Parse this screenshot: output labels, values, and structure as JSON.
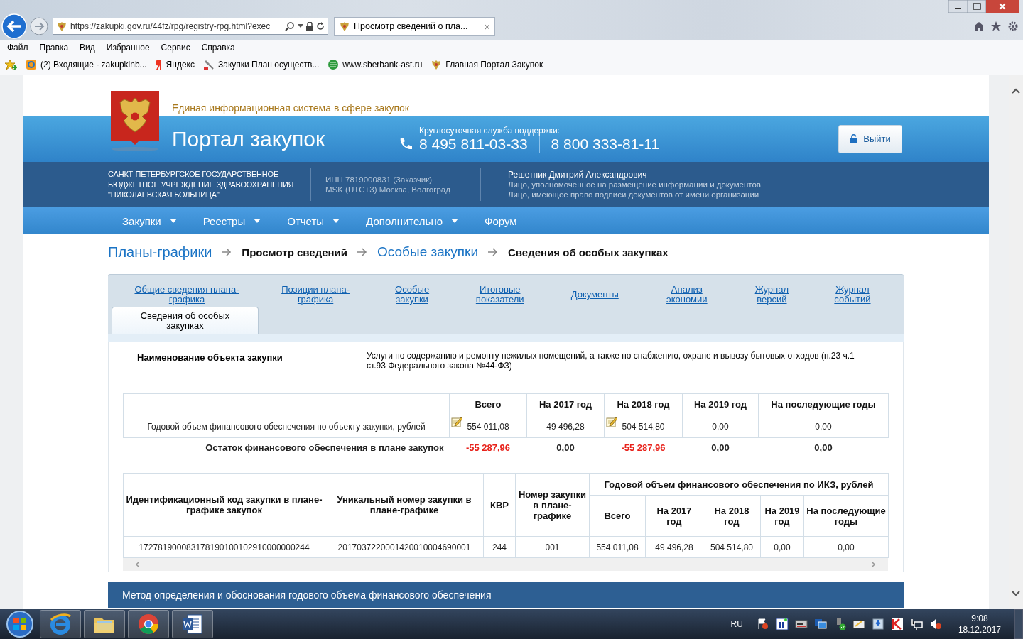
{
  "browser": {
    "address": "https://zakupki.gov.ru/44fz/rpg/registry-rpg.html?exec",
    "tab": {
      "title": "Просмотр сведений о пла...",
      "close": "×"
    },
    "menu": [
      "Файл",
      "Правка",
      "Вид",
      "Избранное",
      "Сервис",
      "Справка"
    ],
    "favorites": [
      "(2) Входящие - zakupkinb...",
      "Яндекс",
      "Закупки План осуществ...",
      "www.sberbank-ast.ru",
      "Главная Портал Закупок"
    ]
  },
  "header": {
    "tagline": "Единая информационная система в сфере закупок",
    "title": "Портал закупок",
    "support_label": "Круглосуточная служба поддержки:",
    "phones": [
      "8 495 811-03-33",
      "8 800 333-81-11"
    ],
    "logout": "Выйти"
  },
  "org": {
    "name": "САНКТ-ПЕТЕРБУРГСКОЕ ГОСУДАРСТВЕННОЕ БЮДЖЕТНОЕ УЧРЕЖДЕНИЕ ЗДРАВООХРАНЕНИЯ \"НИКОЛАЕВСКАЯ БОЛЬНИЦА\"",
    "inn": "ИНН 7819000831 (Заказчик)",
    "timezone": "MSK (UTC+3) Москва, Волгоград",
    "user": "Решетник Дмитрий Александрович",
    "roles": [
      "Лицо, уполномоченное на размещение информации и документов",
      "Лицо, имеющее право подписи документов от имени организации"
    ]
  },
  "nav": [
    {
      "label": "Закупки",
      "dropdown": true
    },
    {
      "label": "Реестры",
      "dropdown": true
    },
    {
      "label": "Отчеты",
      "dropdown": true
    },
    {
      "label": "Дополнительно",
      "dropdown": true
    },
    {
      "label": "Форум",
      "dropdown": false
    }
  ],
  "breadcrumb": [
    {
      "label": "Планы-графики",
      "kind": "link"
    },
    {
      "label": "Просмотр сведений",
      "kind": "current"
    },
    {
      "label": "Особые закупки",
      "kind": "link"
    },
    {
      "label": "Сведения об особых закупках",
      "kind": "current"
    }
  ],
  "tabs": [
    {
      "label": "Общие сведения плана-графика",
      "selected": false
    },
    {
      "label": "Позиции плана-графика",
      "selected": false
    },
    {
      "label": "Особые закупки",
      "selected": false
    },
    {
      "label": "Итоговые показатели",
      "selected": false
    },
    {
      "label": "Документы",
      "selected": false
    },
    {
      "label": "Анализ экономии",
      "selected": false
    },
    {
      "label": "Журнал версий",
      "selected": false
    },
    {
      "label": "Журнал событий",
      "selected": false
    },
    {
      "label": "Сведения об особых закупках",
      "selected": true
    }
  ],
  "object": {
    "label": "Наименование объекта закупки",
    "value": "Услуги по содержанию и ремонту нежилых помещений, а также по снабжению, охране и вывозу бытовых отходов (п.23 ч.1 ст.93 Федерального закона №44-ФЗ)"
  },
  "finance_table": {
    "columns": [
      "Всего",
      "На 2017 год",
      "На 2018 год",
      "На 2019 год",
      "На последующие годы"
    ],
    "row": {
      "label": "Годовой объем финансового обеспечения по объекту закупки, рублей",
      "cells": [
        {
          "value": "554 011,08",
          "editable": true
        },
        {
          "value": "49 496,28",
          "editable": false
        },
        {
          "value": "504 514,80",
          "editable": true
        },
        {
          "value": "0,00",
          "editable": false
        },
        {
          "value": "0,00",
          "editable": false
        }
      ]
    },
    "remainder": {
      "label": "Остаток финансового обеспечения в плане закупок",
      "values": [
        {
          "value": "-55 287,96",
          "negative": true
        },
        {
          "value": "0,00",
          "negative": false
        },
        {
          "value": "-55 287,96",
          "negative": true
        },
        {
          "value": "0,00",
          "negative": false
        },
        {
          "value": "0,00",
          "negative": false
        }
      ]
    }
  },
  "ikz_table": {
    "columns": [
      "Идентификационный код закупки в плане-графике закупок",
      "Уникальный номер закупки в плане-графике",
      "КВР",
      "Номер закупки в плане-графике"
    ],
    "group": "Годовой объем финансового обеспечения по ИКЗ, рублей",
    "subcolumns": [
      "Всего",
      "На 2017 год",
      "На 2018 год",
      "На 2019 год",
      "На последующие годы"
    ],
    "row": [
      "172781900083178190100102910000000244",
      "2017037220001420010004690001",
      "244",
      "001",
      "554 011,08",
      "49 496,28",
      "504 514,80",
      "0,00",
      "0,00"
    ]
  },
  "section": {
    "title": "Метод определения и обоснования годового объема финансового обеспечения"
  },
  "taskbar": {
    "language": "RU",
    "time": "9:08",
    "date": "18.12.2017"
  }
}
